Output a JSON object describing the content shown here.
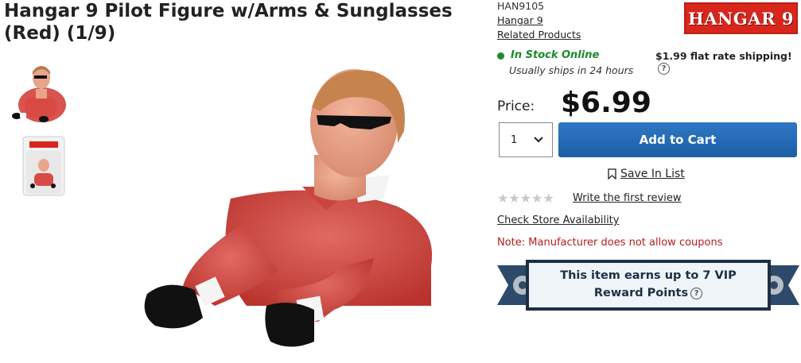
{
  "product": {
    "title": "Hangar 9 Pilot Figure w/Arms & Sunglasses (Red) (1/9)",
    "sku": "HAN9105",
    "brand_link": "Hangar 9",
    "related_link": "Related Products",
    "logo_text": "HANGAR 9"
  },
  "availability": {
    "stock_text": "In Stock Online",
    "ships_text": "Usually ships in 24 hours",
    "shipping_text": "$1.99 flat rate shipping!"
  },
  "purchase": {
    "price_label": "Price:",
    "price_value": "$6.99",
    "quantity": "1",
    "add_to_cart_label": "Add to Cart",
    "save_list_label": "Save In List"
  },
  "reviews": {
    "stars": "★★★★★",
    "rating": 0,
    "review_link": "Write the first review"
  },
  "store_availability_link": "Check Store Availability",
  "coupon_note": "Note: Manufacturer does not allow coupons",
  "vip": {
    "line1": "This item earns up to 7 VIP",
    "line2": "Reward Points"
  },
  "colors": {
    "brand_red": "#d9261c",
    "in_stock_green": "#1a8a2a",
    "cart_blue": "#1c5ea6",
    "coupon_red": "#b51c1c",
    "vip_navy": "#1d2f45"
  },
  "icons": [
    "help-icon",
    "bookmark-icon",
    "chevron-down-icon",
    "star-icon",
    "gear-icon"
  ]
}
